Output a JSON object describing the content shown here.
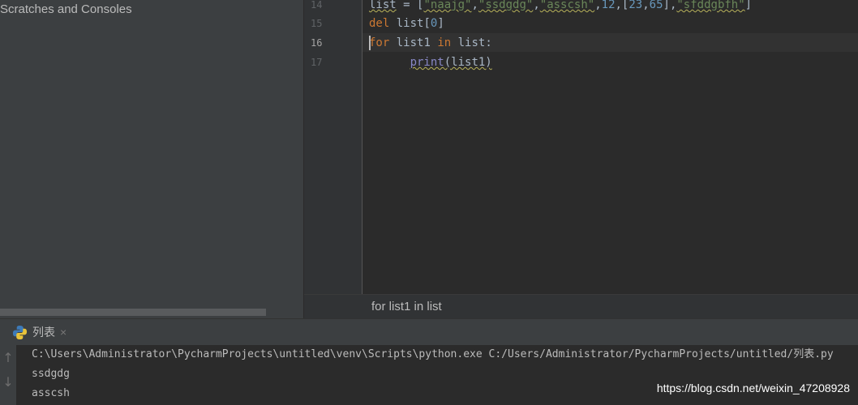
{
  "sidebar": {
    "item": "Scratches and Consoles"
  },
  "editor": {
    "lines": [
      {
        "num": "14",
        "current": false
      },
      {
        "num": "15",
        "current": false
      },
      {
        "num": "16",
        "current": true
      },
      {
        "num": "17",
        "current": false
      }
    ],
    "code": {
      "l14": {
        "a": "list",
        "b": " = [",
        "s1": "\"naajg\"",
        "c1": ",",
        "s2": "\"ssdgdg\"",
        "c2": ",",
        "s3": "\"asscsh\"",
        "c3": ",",
        "n1": "12",
        "c4": ",[",
        "n2": "23",
        "c5": ",",
        "n3": "65",
        "c6": "],",
        "s4": "\"sfddgbfh\"",
        "e": "]"
      },
      "l15": {
        "kw": "del",
        "rest": " list[",
        "n": "0",
        "e": "]"
      },
      "l16": {
        "kw1": "for",
        "a": " list1 ",
        "kw2": "in",
        "b": " list:"
      },
      "l17": {
        "indent": "      ",
        "fn": "print",
        "rest": "(list1)"
      }
    },
    "breadcrumb": "for list1 in list"
  },
  "run": {
    "tab_label": "列表",
    "close": "×",
    "up": "↑",
    "down": "↓",
    "output": [
      "C:\\Users\\Administrator\\PycharmProjects\\untitled\\venv\\Scripts\\python.exe C:/Users/Administrator/PycharmProjects/untitled/列表.py",
      "ssdgdg",
      "asscsh"
    ]
  },
  "watermark": "https://blog.csdn.net/weixin_47208928"
}
